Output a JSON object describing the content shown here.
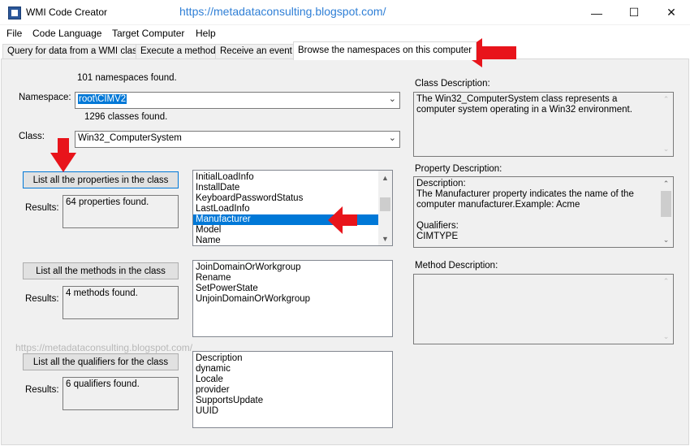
{
  "window": {
    "title": "WMI Code Creator",
    "watermark": "https://metadataconsulting.blogspot.com/",
    "minimize": "—",
    "maximize": "☐",
    "close": "✕"
  },
  "menu": [
    "File",
    "Code Language",
    "Target Computer",
    "Help"
  ],
  "tabs": [
    "Query for data from a WMI class",
    "Execute a method",
    "Receive an event",
    "Browse the namespaces on this computer"
  ],
  "namespace": {
    "count_text": "101 namespaces found.",
    "label": "Namespace:",
    "value": "root\\CIMV2",
    "classes_text": "1296 classes found."
  },
  "class": {
    "label": "Class:",
    "value": "Win32_ComputerSystem"
  },
  "properties": {
    "button": "List all the properties in the class",
    "results_label": "Results:",
    "results": "64 properties found.",
    "items": [
      "InitialLoadInfo",
      "InstallDate",
      "KeyboardPasswordStatus",
      "LastLoadInfo",
      "Manufacturer",
      "Model",
      "Name"
    ],
    "selected_index": 4
  },
  "methods": {
    "button": "List all the methods in the class",
    "results_label": "Results:",
    "results": "4 methods found.",
    "items": [
      "JoinDomainOrWorkgroup",
      "Rename",
      "SetPowerState",
      "UnjoinDomainOrWorkgroup"
    ]
  },
  "qualifiers": {
    "button": "List all the qualifiers for the class",
    "results_label": "Results:",
    "results": "6 qualifiers found.",
    "items": [
      "Description",
      "dynamic",
      "Locale",
      "provider",
      "SupportsUpdate",
      "UUID"
    ]
  },
  "class_description": {
    "label": "Class Description:",
    "text": "The Win32_ComputerSystem class represents a computer system operating in a Win32 environment."
  },
  "property_description": {
    "label": "Property Description:",
    "line1": "Description:",
    "line2": "The Manufacturer property indicates the name of the computer manufacturer.Example: Acme",
    "line3": "Qualifiers:",
    "line4": "CIMTYPE"
  },
  "method_description": {
    "label": "Method Description:",
    "text": ""
  },
  "colors": {
    "accent": "#0078d7",
    "annotation_arrow": "#e8141b",
    "watermark": "#2f7fd6"
  }
}
